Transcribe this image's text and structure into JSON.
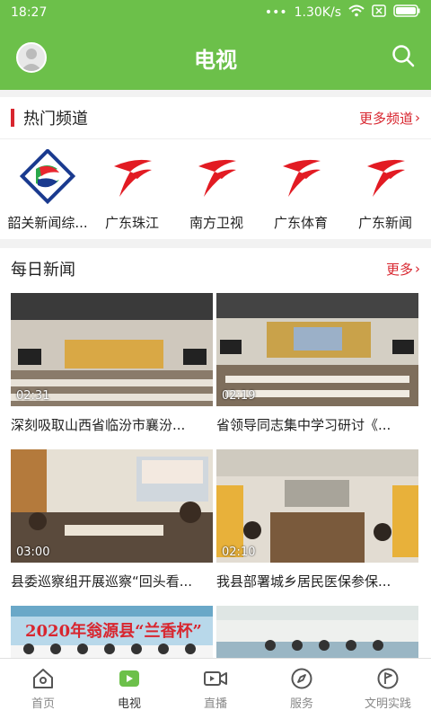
{
  "status": {
    "time": "18:27",
    "speed": "1.30K/s"
  },
  "header": {
    "title": "电视"
  },
  "hot": {
    "title": "热门频道",
    "more": "更多频道",
    "channels": [
      {
        "label": "韶关新闻综..."
      },
      {
        "label": "广东珠江"
      },
      {
        "label": "南方卫视"
      },
      {
        "label": "广东体育"
      },
      {
        "label": "广东新闻"
      }
    ]
  },
  "news": {
    "title": "每日新闻",
    "more": "更多",
    "items": [
      {
        "title": "深刻吸取山西省临汾市襄汾...",
        "duration": "02:31"
      },
      {
        "title": "省领导同志集中学习研讨《...",
        "duration": "02:19"
      },
      {
        "title": "县委巡察组开展巡察“回头看...",
        "duration": "03:00"
      },
      {
        "title": "我县部署城乡居民医保参保...",
        "duration": "02:10"
      },
      {
        "title": "",
        "duration": ""
      },
      {
        "title": "",
        "duration": ""
      }
    ],
    "banner_text": "2020年翁源县“兰香杯”"
  },
  "tabs": [
    {
      "label": "首页"
    },
    {
      "label": "电视"
    },
    {
      "label": "直播"
    },
    {
      "label": "服务"
    },
    {
      "label": "文明实践"
    }
  ],
  "colors": {
    "primary": "#6cc04a",
    "accent": "#d8262f"
  }
}
